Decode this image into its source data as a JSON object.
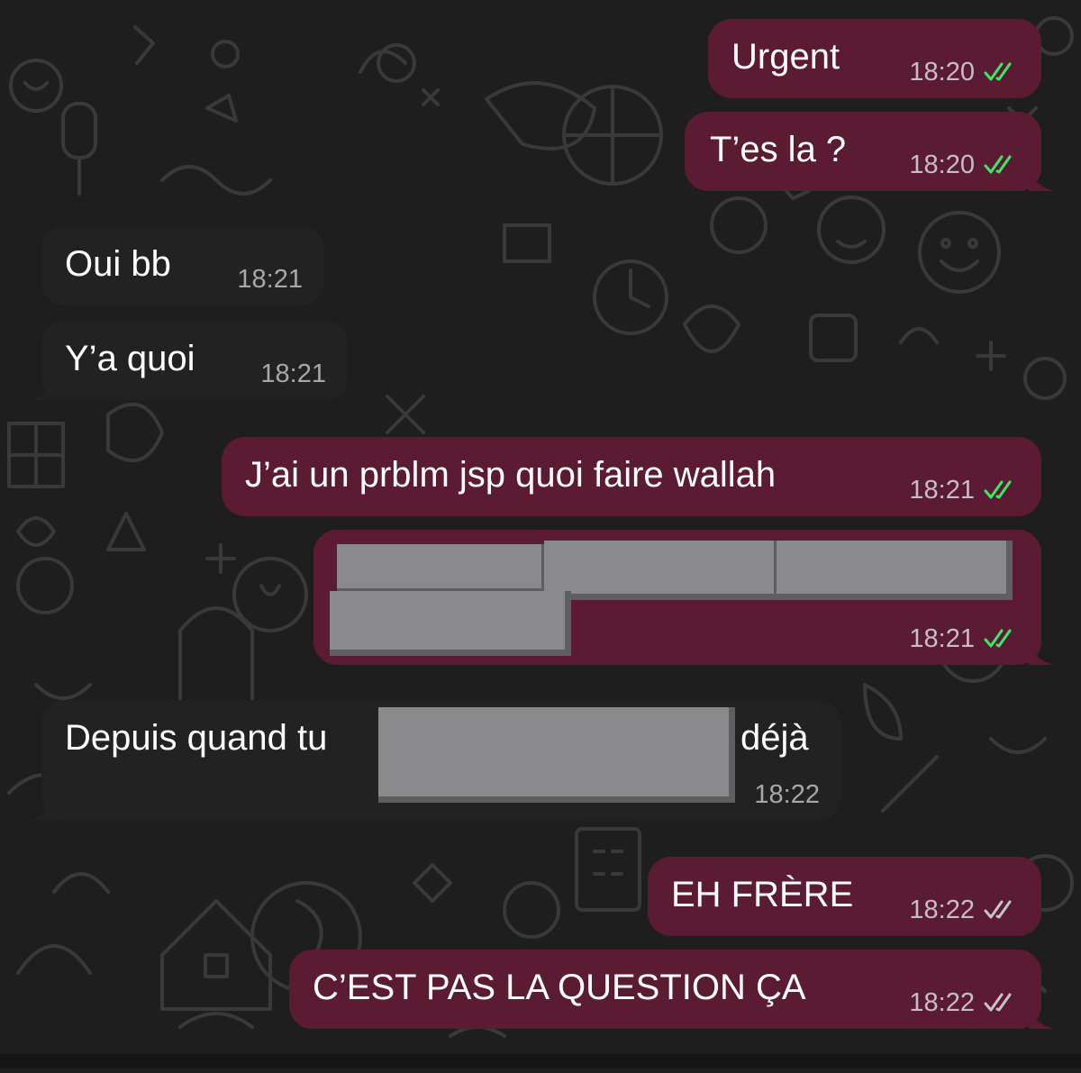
{
  "colors": {
    "background": "#1f1e1f",
    "outgoing_bubble": "#5a1b33",
    "incoming_bubble": "#222223",
    "read_ticks": "#3be866",
    "delivered_ticks": "#c9c2c6",
    "redaction": "#8a8a8d"
  },
  "messages": [
    {
      "direction": "outgoing",
      "text": "Urgent",
      "time": "18:20",
      "status": "read"
    },
    {
      "direction": "outgoing",
      "text": "T’es la ?",
      "time": "18:20",
      "status": "read"
    },
    {
      "direction": "incoming",
      "text": "Oui bb",
      "time": "18:21"
    },
    {
      "direction": "incoming",
      "text": "Y’a quoi",
      "time": "18:21"
    },
    {
      "direction": "outgoing",
      "text": "J’ai un prblm jsp quoi faire wallah",
      "time": "18:21",
      "status": "read"
    },
    {
      "direction": "outgoing",
      "text": "",
      "time": "18:21",
      "status": "read",
      "redacted": true
    },
    {
      "direction": "incoming",
      "text_before": "Depuis quand tu",
      "text_after": "déjà",
      "time": "18:22",
      "redacted": true
    },
    {
      "direction": "outgoing",
      "text": "EH FRÈRE",
      "time": "18:22",
      "status": "delivered"
    },
    {
      "direction": "outgoing",
      "text": "C’EST PAS LA QUESTION ÇA",
      "time": "18:22",
      "status": "delivered"
    }
  ],
  "icons": {
    "read": "double-check-icon",
    "delivered": "double-check-icon",
    "wallpaper": "doodle-pattern"
  }
}
